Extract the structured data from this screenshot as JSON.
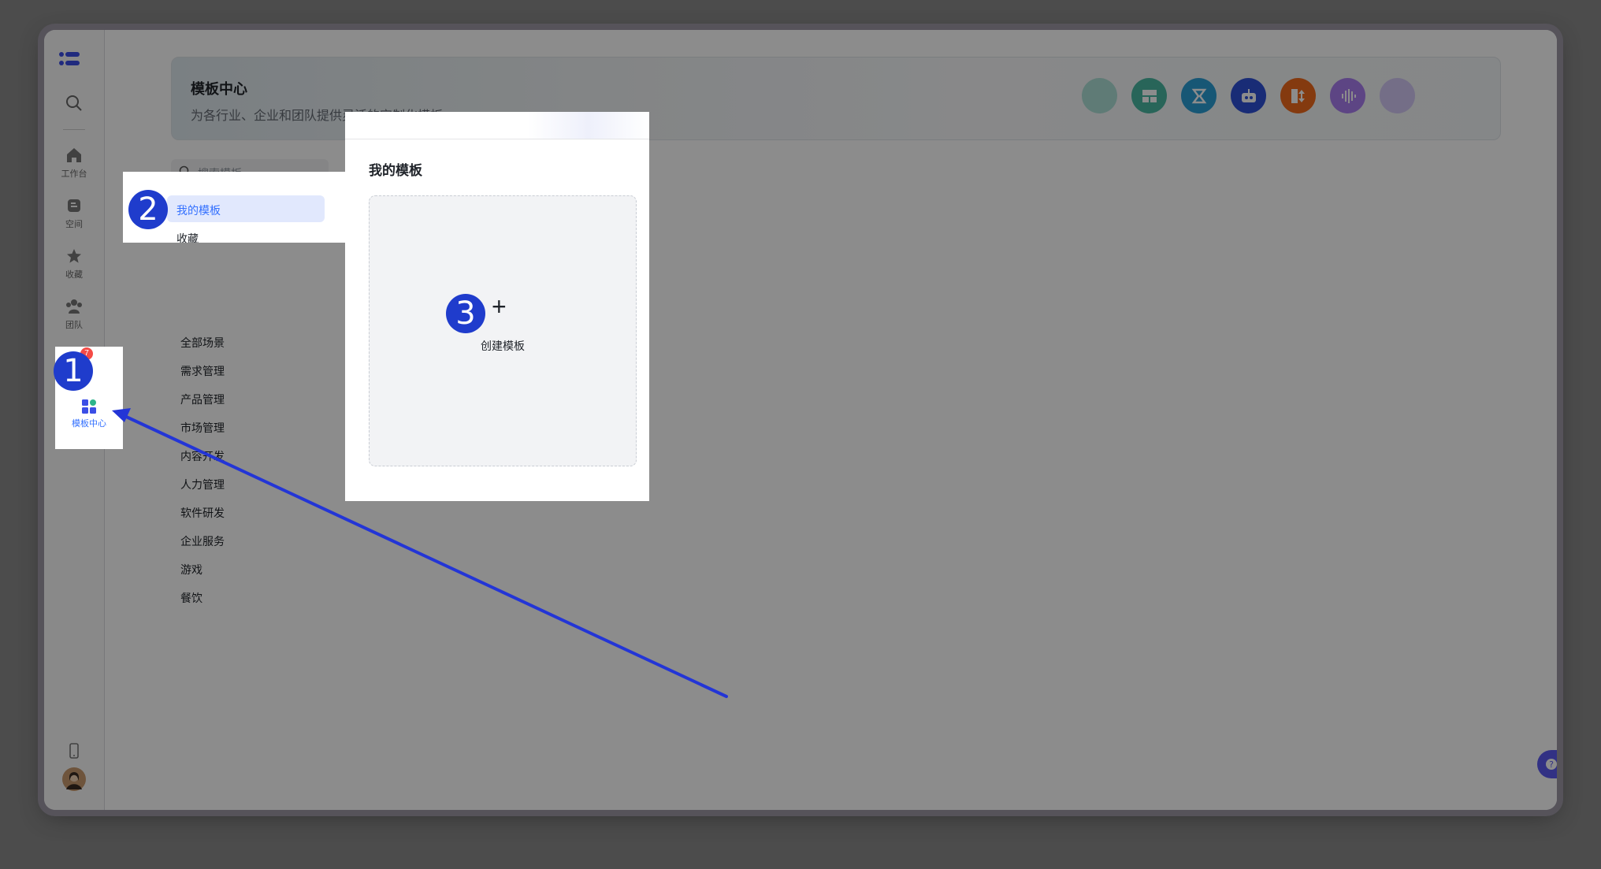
{
  "rail": {
    "items": [
      {
        "label": "工作台",
        "icon": "home-icon"
      },
      {
        "label": "空间",
        "icon": "space-icon"
      },
      {
        "label": "收藏",
        "icon": "star-icon"
      },
      {
        "label": "团队",
        "icon": "team-icon"
      },
      {
        "label": "模板中心",
        "icon": "template-icon",
        "badge": "7"
      }
    ]
  },
  "banner": {
    "title": "模板中心",
    "subtitle": "为各行业、企业和团队提供灵活的定制化模板",
    "icon_colors": [
      "#7fd1c2",
      "#49b8a2",
      "#2b9ed6",
      "#2f51d8",
      "#f06a1d",
      "#a97ef0",
      "#c6b6f5"
    ]
  },
  "left_nav": {
    "search_placeholder": "搜索模板",
    "my_templates": "我的模板",
    "favorites": "收藏",
    "categories": [
      "全部场景",
      "需求管理",
      "产品管理",
      "市场管理",
      "内容开发",
      "人力管理",
      "软件研发",
      "企业服务",
      "游戏",
      "餐饮"
    ]
  },
  "main": {
    "section_title": "我的模板",
    "create_label": "创建模板",
    "create_plus": "+"
  },
  "help": {
    "label": "帮助"
  },
  "markers": {
    "one": "1",
    "two": "2",
    "three": "3"
  },
  "colors": {
    "accent": "#3370ff",
    "marker": "#1f3ccc",
    "arrow": "#2335d6"
  }
}
